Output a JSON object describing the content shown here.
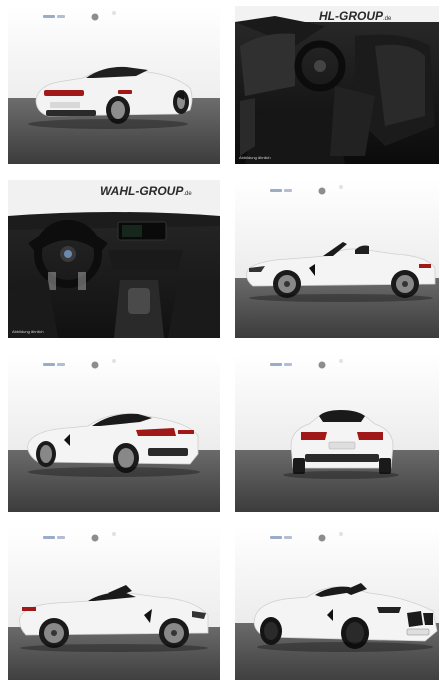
{
  "gallery": {
    "dealer_logo": {
      "name": "WAHL-GROUP",
      "name_partial": "HL-GROUP",
      "suffix": ".de"
    },
    "interior_caption": "Abbildung ähnlich",
    "images": [
      {
        "view": "rear-three-quarter-left"
      },
      {
        "view": "interior-seats"
      },
      {
        "view": "interior-dashboard"
      },
      {
        "view": "side-right"
      },
      {
        "view": "rear-three-quarter-left-low"
      },
      {
        "view": "rear"
      },
      {
        "view": "side-left"
      },
      {
        "view": "front-three-quarter-right"
      }
    ]
  }
}
